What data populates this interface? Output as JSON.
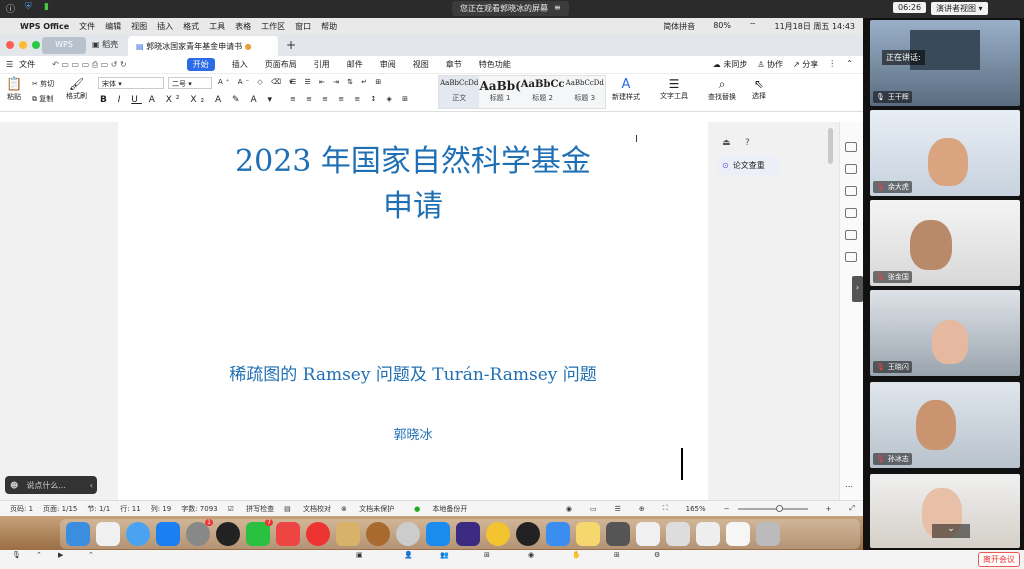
{
  "meeting": {
    "share_notice": "您正在观看郭晓冰的屏幕",
    "timer": "06:26",
    "speaker_view": "演讲者视图",
    "speaking_label": "正在讲话:",
    "leave_button": "离开会议"
  },
  "macbar": {
    "app": "WPS Office",
    "menus": [
      "文件",
      "编辑",
      "视图",
      "插入",
      "格式",
      "工具",
      "表格",
      "工作区",
      "窗口",
      "帮助"
    ],
    "input_method": "简体拼音",
    "battery": "80%",
    "datetime": "11月18日 周五 14:43"
  },
  "tabs": {
    "wps": "WPS",
    "shell": "稻壳",
    "doc": "郭晓冰国家青年基金申请书"
  },
  "menubar": {
    "file": "文件",
    "items": [
      "开始",
      "插入",
      "页面布局",
      "引用",
      "邮件",
      "审阅",
      "视图",
      "章节",
      "特色功能"
    ],
    "unsynced": "未同步",
    "collab": "协作",
    "share": "分享"
  },
  "ribbon": {
    "paste": "粘贴",
    "cut": "剪切",
    "copy": "复制",
    "format_painter": "格式刷",
    "font": "宋体",
    "size": "二号",
    "styles": [
      {
        "preview": "AaBbCcDd",
        "name": "正文"
      },
      {
        "preview": "AaBb(",
        "name": "标题 1"
      },
      {
        "preview": "AaBbCc",
        "name": "标题 2"
      },
      {
        "preview": "AaBbCcDd",
        "name": "标题 3"
      }
    ],
    "new_style": "新建样式",
    "text_tools": "文字工具",
    "find_replace": "查找替换",
    "select": "选择"
  },
  "document": {
    "title_line1": "2023 年国家自然科学基金",
    "title_line2": "申请",
    "subtitle": "稀疏图的 Ramsey 问题及 Turán-Ramsey 问题",
    "author": "郭晓冰"
  },
  "side_panel": {
    "paper_check": "论文查重"
  },
  "chat": {
    "placeholder": "说点什么..."
  },
  "statusbar": {
    "page": "页码: 1",
    "pages": "页面: 1/15",
    "section": "节: 1/1",
    "row": "行: 11",
    "col": "列: 19",
    "words": "字数: 7093",
    "spellcheck": "拼写检查",
    "proofread": "文档校对",
    "unprotected": "文档未保护",
    "backup": "本地备份开",
    "zoom": "165%"
  },
  "participants": [
    {
      "name": "王干辉"
    },
    {
      "name": "余大虎"
    },
    {
      "name": "张金国"
    },
    {
      "name": "王晓闪"
    },
    {
      "name": "孙冰志"
    },
    {
      "name": ""
    }
  ],
  "colors": {
    "accent": "#2b6be6",
    "doc_title": "#1f6fb4",
    "leave": "#e33333"
  }
}
